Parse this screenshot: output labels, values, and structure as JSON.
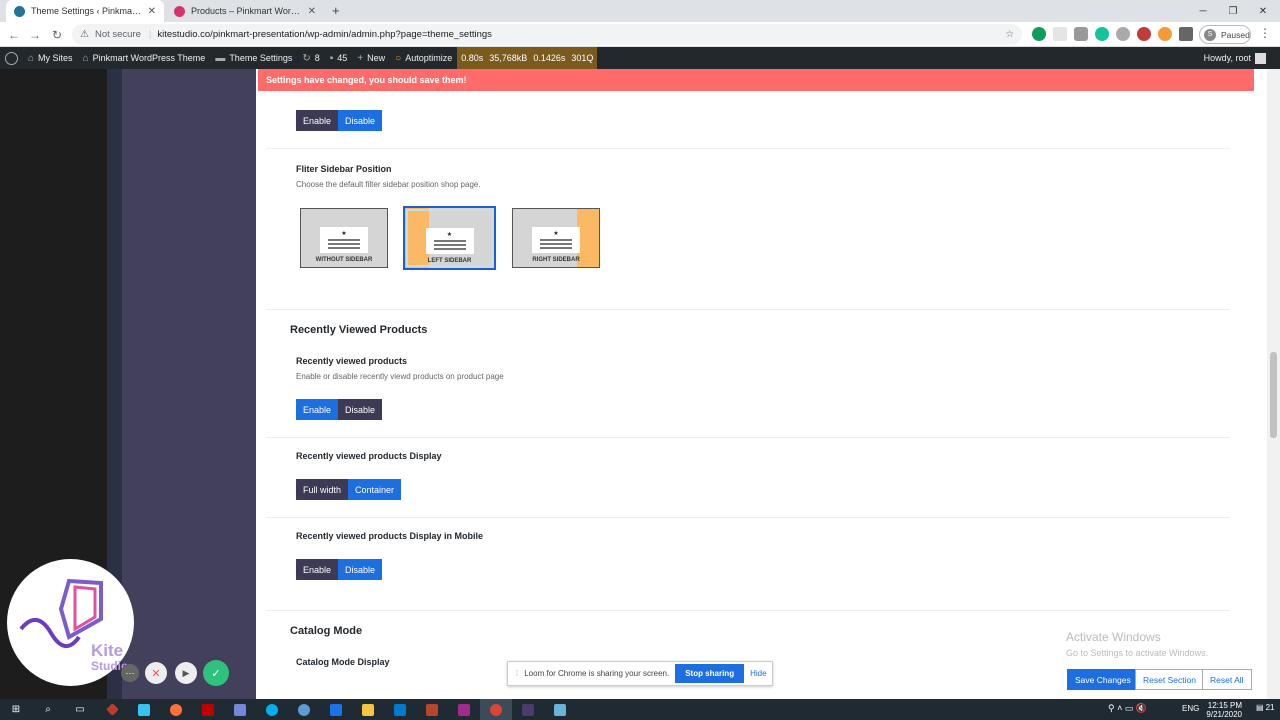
{
  "browser": {
    "tabs": [
      {
        "title": "Theme Settings ‹ Pinkmart Word",
        "active": true,
        "favicon_color": "#21759b"
      },
      {
        "title": "Products – Pinkmart WordPress T",
        "active": false,
        "favicon_color": "#d6336c"
      }
    ],
    "new_tab_icon": "plus-icon",
    "not_secure": "Not secure",
    "url": "kitestudio.co/pinkmart-presentation/wp-admin/admin.php?page=theme_settings",
    "profile_initial": "S",
    "profile_status": "Paused"
  },
  "adminbar": {
    "my_sites": "My Sites",
    "site_name": "Pinkmart WordPress Theme",
    "theme_settings": "Theme Settings",
    "updates_count": "8",
    "comments_count": "45",
    "new_label": "New",
    "autoptimize": "Autoptimize",
    "stats": [
      "0.80s",
      "35,768kB",
      "0.1426s",
      "301Q"
    ],
    "howdy": "Howdy, root"
  },
  "notice": "Settings have changed, you should save them!",
  "sections": {
    "sidebar_enable": {
      "enable": "Enable",
      "disable": "Disable",
      "selected": "Disable"
    },
    "filter_sidebar": {
      "title": "Fliter Sidebar Position",
      "desc": "Choose the default filter sidebar position shop page.",
      "options": [
        "WITHOUT SIDEBAR",
        "LEFT SIDEBAR",
        "RIGHT SIDEBAR"
      ],
      "selected": "LEFT SIDEBAR"
    },
    "recently_viewed": {
      "heading": "Recently Viewed Products",
      "field1_title": "Recently viewed products",
      "field1_desc": "Enable or disable recently viewd products on product page",
      "field1_enable": "Enable",
      "field1_disable": "Disable",
      "field2_title": "Recently viewed products Display",
      "field2_full": "Full width",
      "field2_container": "Container",
      "field3_title": "Recently viewed products Display in Mobile",
      "field3_enable": "Enable",
      "field3_disable": "Disable"
    },
    "catalog": {
      "heading": "Catalog Mode",
      "sub": "Catalog Mode Display"
    }
  },
  "footer": {
    "save": "Save Changes",
    "reset_section": "Reset Section",
    "reset_all": "Reset All"
  },
  "activate": {
    "title": "Activate Windows",
    "sub": "Go to Settings to activate Windows."
  },
  "loom": {
    "text": "Loom for Chrome is sharing your screen.",
    "stop": "Stop sharing",
    "hide": "Hide"
  },
  "kite": {
    "line1": "Kite",
    "line2": "Studio"
  },
  "taskbar": {
    "time": "12:15 PM",
    "date": "9/21/2020",
    "lang": "ENG",
    "notif": "21"
  }
}
